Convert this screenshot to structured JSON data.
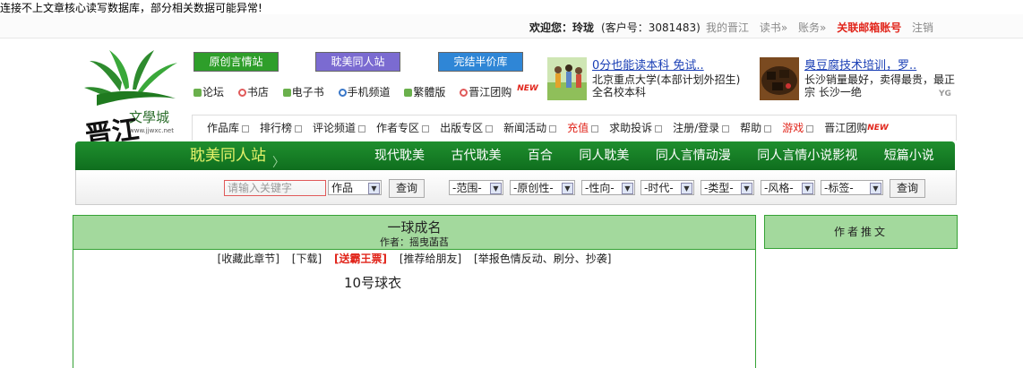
{
  "notice": "连接不上文章核心读写数据库，部分相关数据可能异常!",
  "user": {
    "welcome_prefix": "欢迎您：",
    "name": "玲珑",
    "customer_id": "(客户号：3081483)"
  },
  "top_links": [
    "我的晋江",
    "读书»",
    "账务»",
    "关联邮箱账号",
    "注销"
  ],
  "logo": {
    "main": "晋江",
    "sub": "文學城",
    "url": "www.jjwxc.net"
  },
  "site_buttons": [
    "原创言情站",
    "耽美同人站",
    "完结半价库"
  ],
  "sub_links": [
    "论坛",
    "书店",
    "电子书",
    "手机频道",
    "繁體版",
    "晋江团购"
  ],
  "new_badge": "NEW",
  "ads": [
    {
      "title": "0分也能读本科 免试..",
      "desc": "北京重点大学(本部计划外招生)全名校本科"
    },
    {
      "title": "臭豆腐技术培训，罗..",
      "desc": "长沙销量最好，卖得最贵，最正宗 长沙一绝"
    }
  ],
  "ad_badge": "YG",
  "menu": [
    "作品库",
    "排行榜",
    "评论频道",
    "作者专区",
    "出版专区",
    "新闻活动",
    "充值",
    "求助投诉",
    "注册/登录",
    "帮助",
    "游戏",
    "晋江团购"
  ],
  "channel": {
    "name": "耽美同人站",
    "nav": [
      "现代耽美",
      "古代耽美",
      "百合",
      "同人耽美",
      "同人言情动漫",
      "同人言情小说影视",
      "短篇小说"
    ]
  },
  "search": {
    "placeholder": "请输入关键字",
    "type": "作品",
    "button": "查询",
    "filters": [
      "-范围-",
      "-原创性-",
      "-性向-",
      "-时代-",
      "-类型-",
      "-风格-",
      "-标签-"
    ],
    "filter_button": "查询"
  },
  "novel": {
    "title": "一球成名",
    "author": "作者：摇曳菡萏",
    "actions": [
      "[收藏此章节]",
      "[下载]",
      "[送霸王票]",
      "[推荐给朋友]",
      "[举报色情反动、刷分、抄袭]"
    ],
    "chapter": "10号球衣"
  },
  "side_title": "作者推文",
  "colors": {
    "green": "#1f8f2e",
    "light_green": "#a3d99d",
    "red": "#e1251b"
  }
}
